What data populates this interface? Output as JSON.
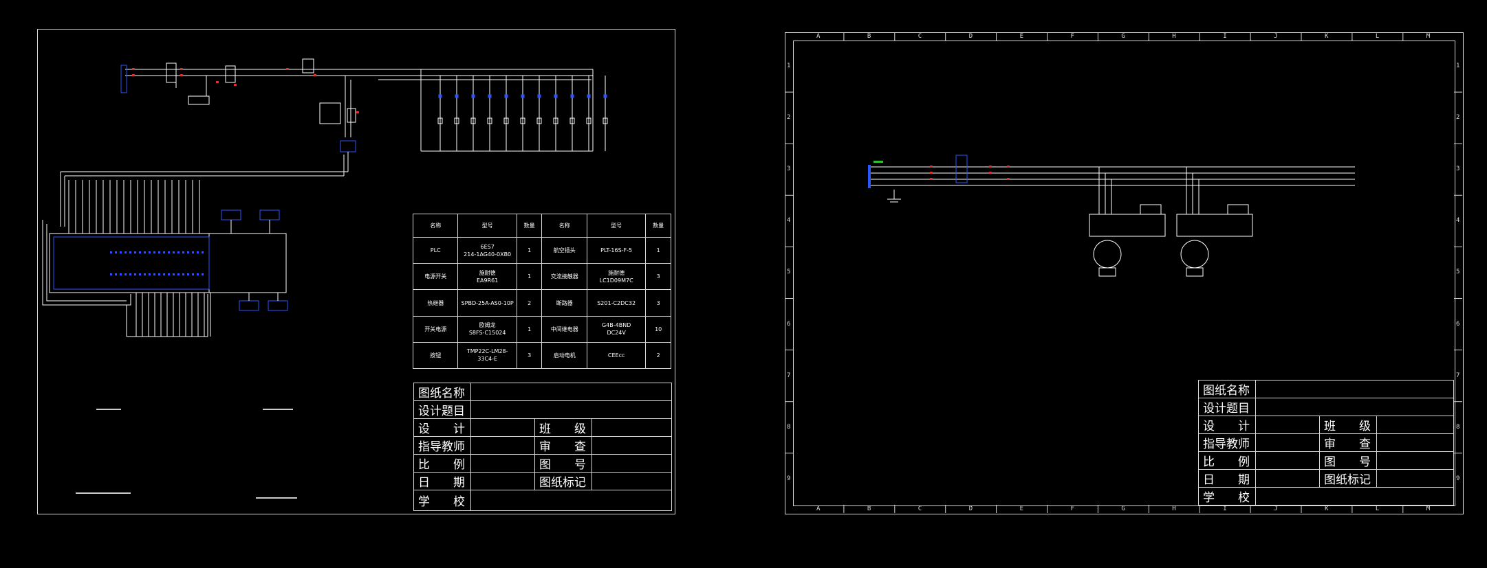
{
  "colors": {
    "background": "#000000",
    "line": "#ffffff",
    "frame": "#d8d8d8",
    "blue": "#2e54ff",
    "red": "#e0322d",
    "green": "#30c030"
  },
  "left_sheet": {
    "parts_table": {
      "headers": [
        "名称",
        "型号",
        "数量",
        "名称",
        "型号",
        "数量"
      ],
      "rows": [
        [
          "PLC",
          "6ES7\n214-1AG40-0XB0",
          "1",
          "航空插头",
          "PLT-16S-F-5",
          "1"
        ],
        [
          "电源开关",
          "施耐德\nEA9R61",
          "1",
          "交流接触器",
          "施耐德\nLC1D09M7C",
          "3"
        ],
        [
          "热继器",
          "SPBD-25A-AS0-10P",
          "2",
          "断路器",
          "S201-C2DC32",
          "3"
        ],
        [
          "开关电源",
          "欧姆龙\nS8FS-C15024",
          "1",
          "中间继电器",
          "G4B-4BND\nDC24V",
          "10"
        ],
        [
          "按钮",
          "TMP22C-LM28-\n33C4-E",
          "3",
          "启动电机",
          "CEEcc",
          "2"
        ]
      ]
    },
    "title_block": {
      "drawing_name": "图纸名称",
      "design_topic": "设计题目",
      "design": "设　　计",
      "class": "班　　级",
      "instructor": "指导教师",
      "review": "审　　查",
      "scale": "比　　例",
      "drawing_no": "图　　号",
      "date": "日　　期",
      "drawing_mark": "图纸标记",
      "school": "学　　校"
    }
  },
  "right_sheet": {
    "zone_columns": [
      "A",
      "B",
      "C",
      "D",
      "E",
      "F",
      "G",
      "H",
      "I",
      "J",
      "K",
      "L",
      "M"
    ],
    "zone_rows": [
      "1",
      "2",
      "3",
      "4",
      "5",
      "6",
      "7",
      "8",
      "9"
    ],
    "title_block": {
      "drawing_name": "图纸名称",
      "design_topic": "设计题目",
      "design": "设　　计",
      "class": "班　　级",
      "instructor": "指导教师",
      "review": "审　　查",
      "scale": "比　　例",
      "drawing_no": "图　　号",
      "date": "日　　期",
      "drawing_mark": "图纸标记",
      "school": "学　　校"
    }
  }
}
